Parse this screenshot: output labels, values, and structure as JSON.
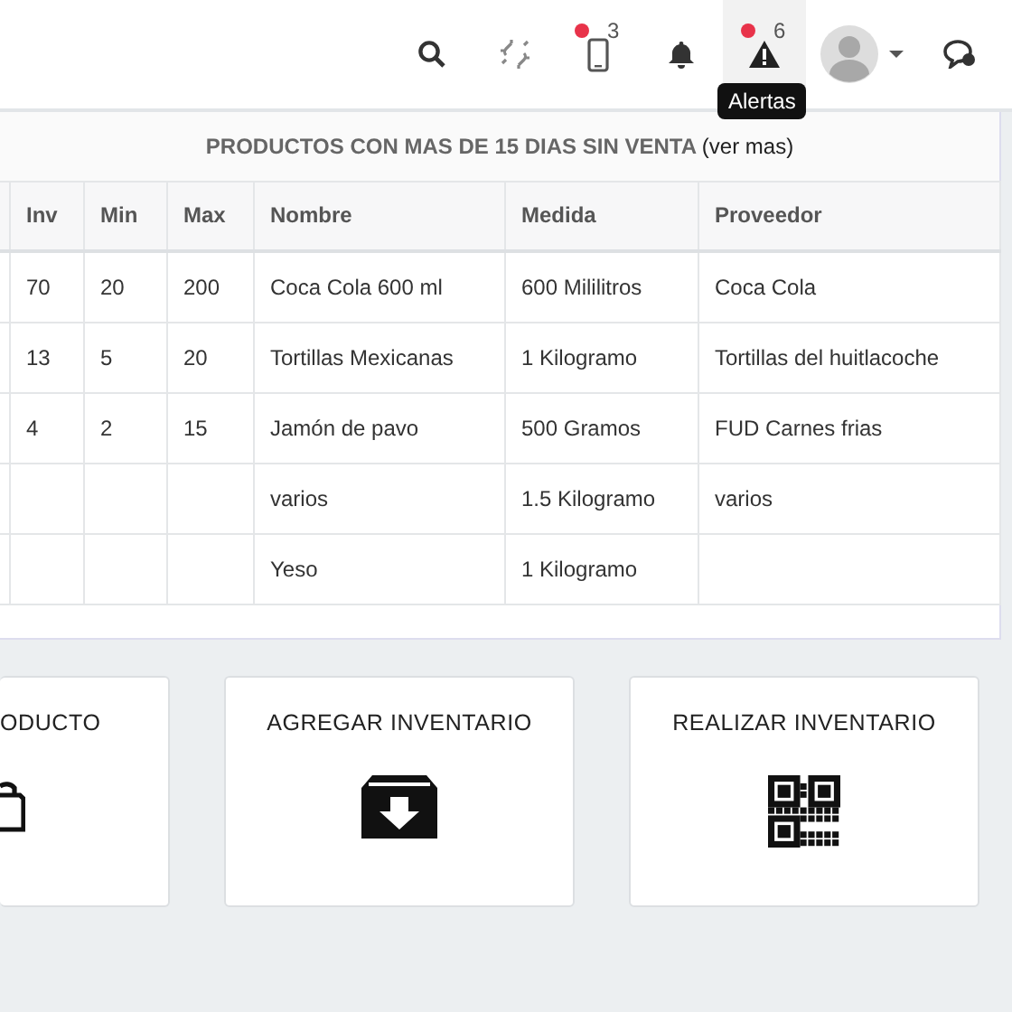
{
  "topbar": {
    "icons": [
      {
        "kind": "search",
        "selected": false,
        "dot": false
      },
      {
        "kind": "unlink",
        "selected": false,
        "dot": false
      },
      {
        "kind": "phone",
        "selected": false,
        "dot": true,
        "count": "3"
      },
      {
        "kind": "bell",
        "selected": false,
        "dot": false
      },
      {
        "kind": "alert",
        "selected": true,
        "dot": true,
        "count": "6",
        "tooltip": "Alertas"
      },
      {
        "kind": "avatar",
        "selected": false,
        "dot": false
      },
      {
        "kind": "chat",
        "selected": false,
        "dot": false
      }
    ]
  },
  "panel": {
    "title": "PRODUCTOS CON MAS DE **15 DIAS** SIN VENTA",
    "link": "(ver mas)",
    "table": {
      "columns": [
        "",
        "Inv",
        "Min",
        "Max",
        "Nombre",
        "Medida",
        "Proveedor"
      ],
      "rows": [
        [
          "",
          "70",
          "20",
          "200",
          "Coca Cola 600 ml",
          "600 Mililitros",
          "Coca Cola"
        ],
        [
          "",
          "13",
          "5",
          "20",
          "Tortillas Mexicanas",
          "1 Kilogramo",
          "Tortillas del huitlacoche"
        ],
        [
          "",
          "4",
          "2",
          "15",
          "Jamón de pavo",
          "500 Gramos",
          "FUD Carnes frias"
        ],
        [
          "",
          "",
          "",
          "",
          "varios",
          "1.5 Kilogramo",
          "varios"
        ],
        [
          "",
          "",
          "",
          "",
          "Yeso",
          "1 Kilogramo",
          ""
        ]
      ]
    }
  },
  "cards": [
    {
      "title": "ODUCTO",
      "kind": "bag"
    },
    {
      "title": "AGREGAR INVENTARIO",
      "kind": "archive"
    },
    {
      "title": "REALIZAR INVENTARIO",
      "kind": "qr"
    }
  ]
}
